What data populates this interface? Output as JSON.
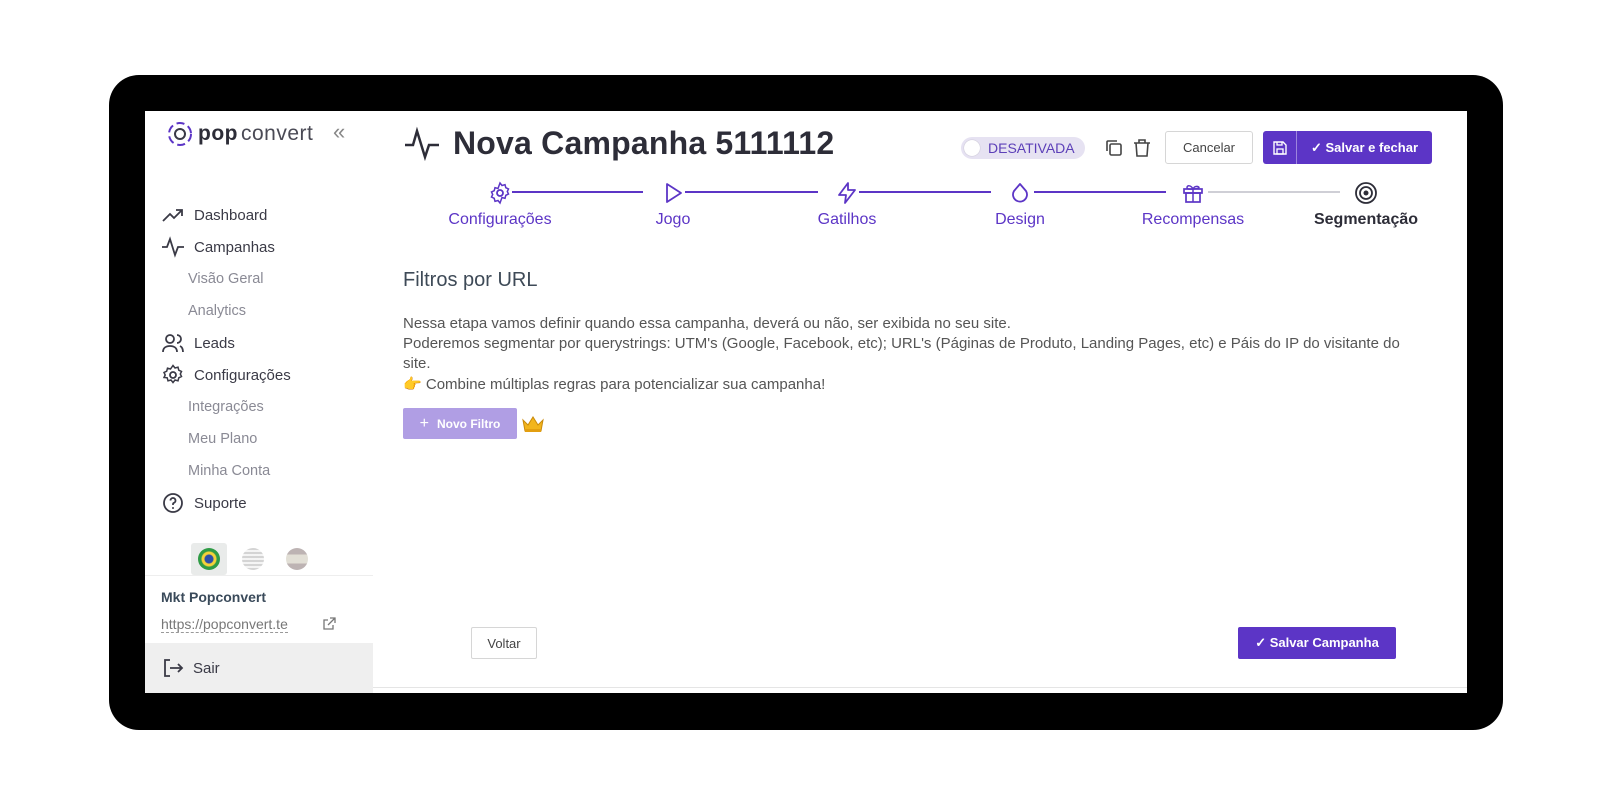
{
  "brand": {
    "logo_pop": "pop",
    "logo_convert": "convert",
    "accent": "#5c35c6"
  },
  "sidebar": {
    "items": [
      {
        "label": "Dashboard",
        "icon": "trending-up-icon"
      },
      {
        "label": "Campanhas",
        "icon": "activity-icon"
      },
      {
        "label": "Visão Geral"
      },
      {
        "label": "Analytics"
      },
      {
        "label": "Leads",
        "icon": "users-icon"
      },
      {
        "label": "Configurações",
        "icon": "gear-icon"
      },
      {
        "label": "Integrações"
      },
      {
        "label": "Meu Plano"
      },
      {
        "label": "Minha Conta"
      },
      {
        "label": "Suporte",
        "icon": "help-circle-icon"
      }
    ],
    "languages": [
      "pt-BR",
      "en-US",
      "es"
    ],
    "account": {
      "name": "Mkt Popconvert",
      "url": "https://popconvert.te"
    },
    "logout_label": "Sair"
  },
  "header": {
    "title": "Nova Campanha 5111112",
    "status": "DESATIVADA",
    "cancel_label": "Cancelar",
    "save_close_label": "✓ Salvar e fechar"
  },
  "stepper": {
    "steps": [
      {
        "label": "Configurações",
        "icon": "gear-icon"
      },
      {
        "label": "Jogo",
        "icon": "play-icon"
      },
      {
        "label": "Gatilhos",
        "icon": "zap-icon"
      },
      {
        "label": "Design",
        "icon": "droplet-icon"
      },
      {
        "label": "Recompensas",
        "icon": "gift-icon"
      },
      {
        "label": "Segmentação",
        "icon": "target-icon"
      }
    ],
    "current": "Segmentação"
  },
  "content": {
    "section_title": "Filtros por URL",
    "line1": "Nessa etapa vamos definir quando essa campanha, deverá ou não, ser exibida no seu site.",
    "line2": "Poderemos segmentar por querystrings: UTM's (Google, Facebook, etc); URL's (Páginas de Produto, Landing Pages, etc) e Páis do IP do visitante do site.",
    "hint_emoji": "👉",
    "hint": "Combine múltiplas regras para potencializar sua campanha!",
    "new_filter_label": "Novo Filtro",
    "new_filter_plus": "+",
    "premium_icon": "crown-icon"
  },
  "footer": {
    "back_label": "Voltar",
    "save_campaign_label": "✓ Salvar Campanha"
  }
}
